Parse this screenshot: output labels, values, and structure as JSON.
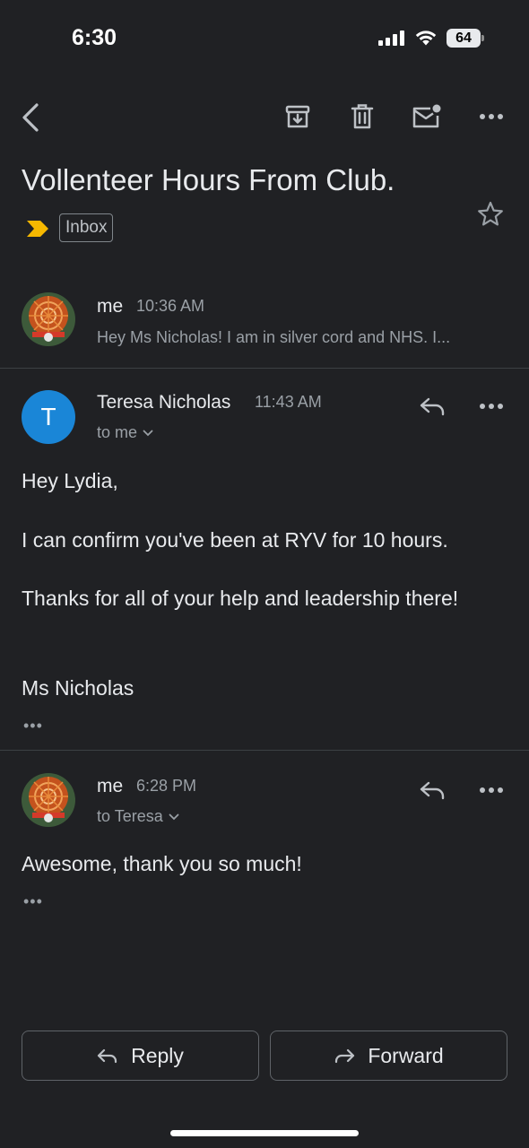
{
  "status_bar": {
    "time": "6:30",
    "battery": "64"
  },
  "thread": {
    "subject": "Vollenteer Hours From Club.",
    "label": "Inbox",
    "colors": {
      "importance": "#f6b800",
      "avatar_t": "#1a86d7",
      "background": "#202124"
    }
  },
  "messages": [
    {
      "sender": "me",
      "time": "10:36 AM",
      "snippet": "Hey Ms Nicholas! I am in silver cord and NHS. I..."
    },
    {
      "sender": "Teresa Nicholas",
      "avatar_letter": "T",
      "time": "11:43 AM",
      "to": "to me",
      "body": [
        "Hey Lydia,",
        "I can confirm you've been at RYV for 10 hours.",
        "Thanks for all of your help and leadership there!",
        "Ms Nicholas"
      ],
      "collapsed_indicator": "•••"
    },
    {
      "sender": "me",
      "time": "6:28 PM",
      "to": "to Teresa",
      "body": [
        "Awesome, thank you so much!"
      ],
      "collapsed_indicator": "•••"
    }
  ],
  "actions": {
    "reply": "Reply",
    "forward": "Forward"
  }
}
